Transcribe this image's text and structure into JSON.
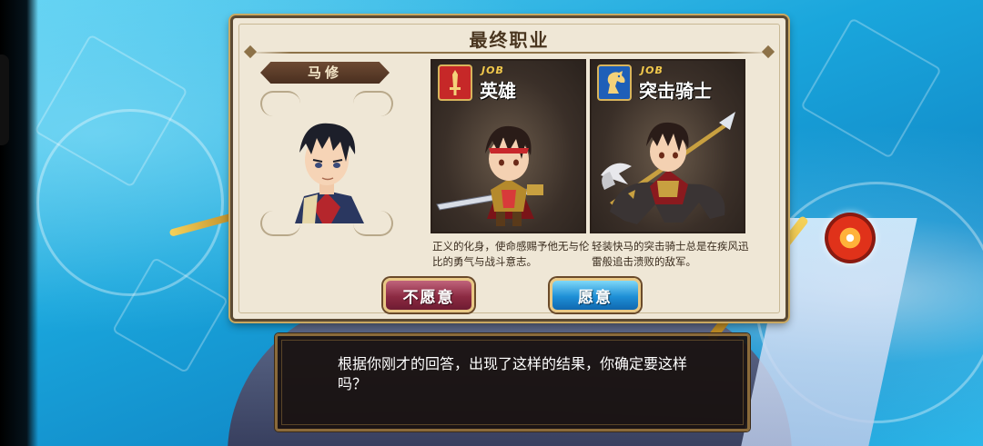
{
  "dialog_title": "最终职业",
  "character": {
    "name": "马修"
  },
  "jobs": [
    {
      "label": "JOB",
      "name": "英雄",
      "badge_icon": "sword-icon",
      "badge_color": "#c62828",
      "description": "正义的化身，使命感赐予他无与伦比的勇气与战斗意志。"
    },
    {
      "label": "JOB",
      "name": "突击骑士",
      "badge_icon": "horse-icon",
      "badge_color": "#1e5fb8",
      "description": "轻装快马的突击骑士总是在疾风迅雷般追击溃败的敌军。"
    }
  ],
  "buttons": {
    "decline": "不愿意",
    "accept": "愿意"
  },
  "message": "根据你刚才的回答，出现了这样的结果，你确定要这样吗？"
}
